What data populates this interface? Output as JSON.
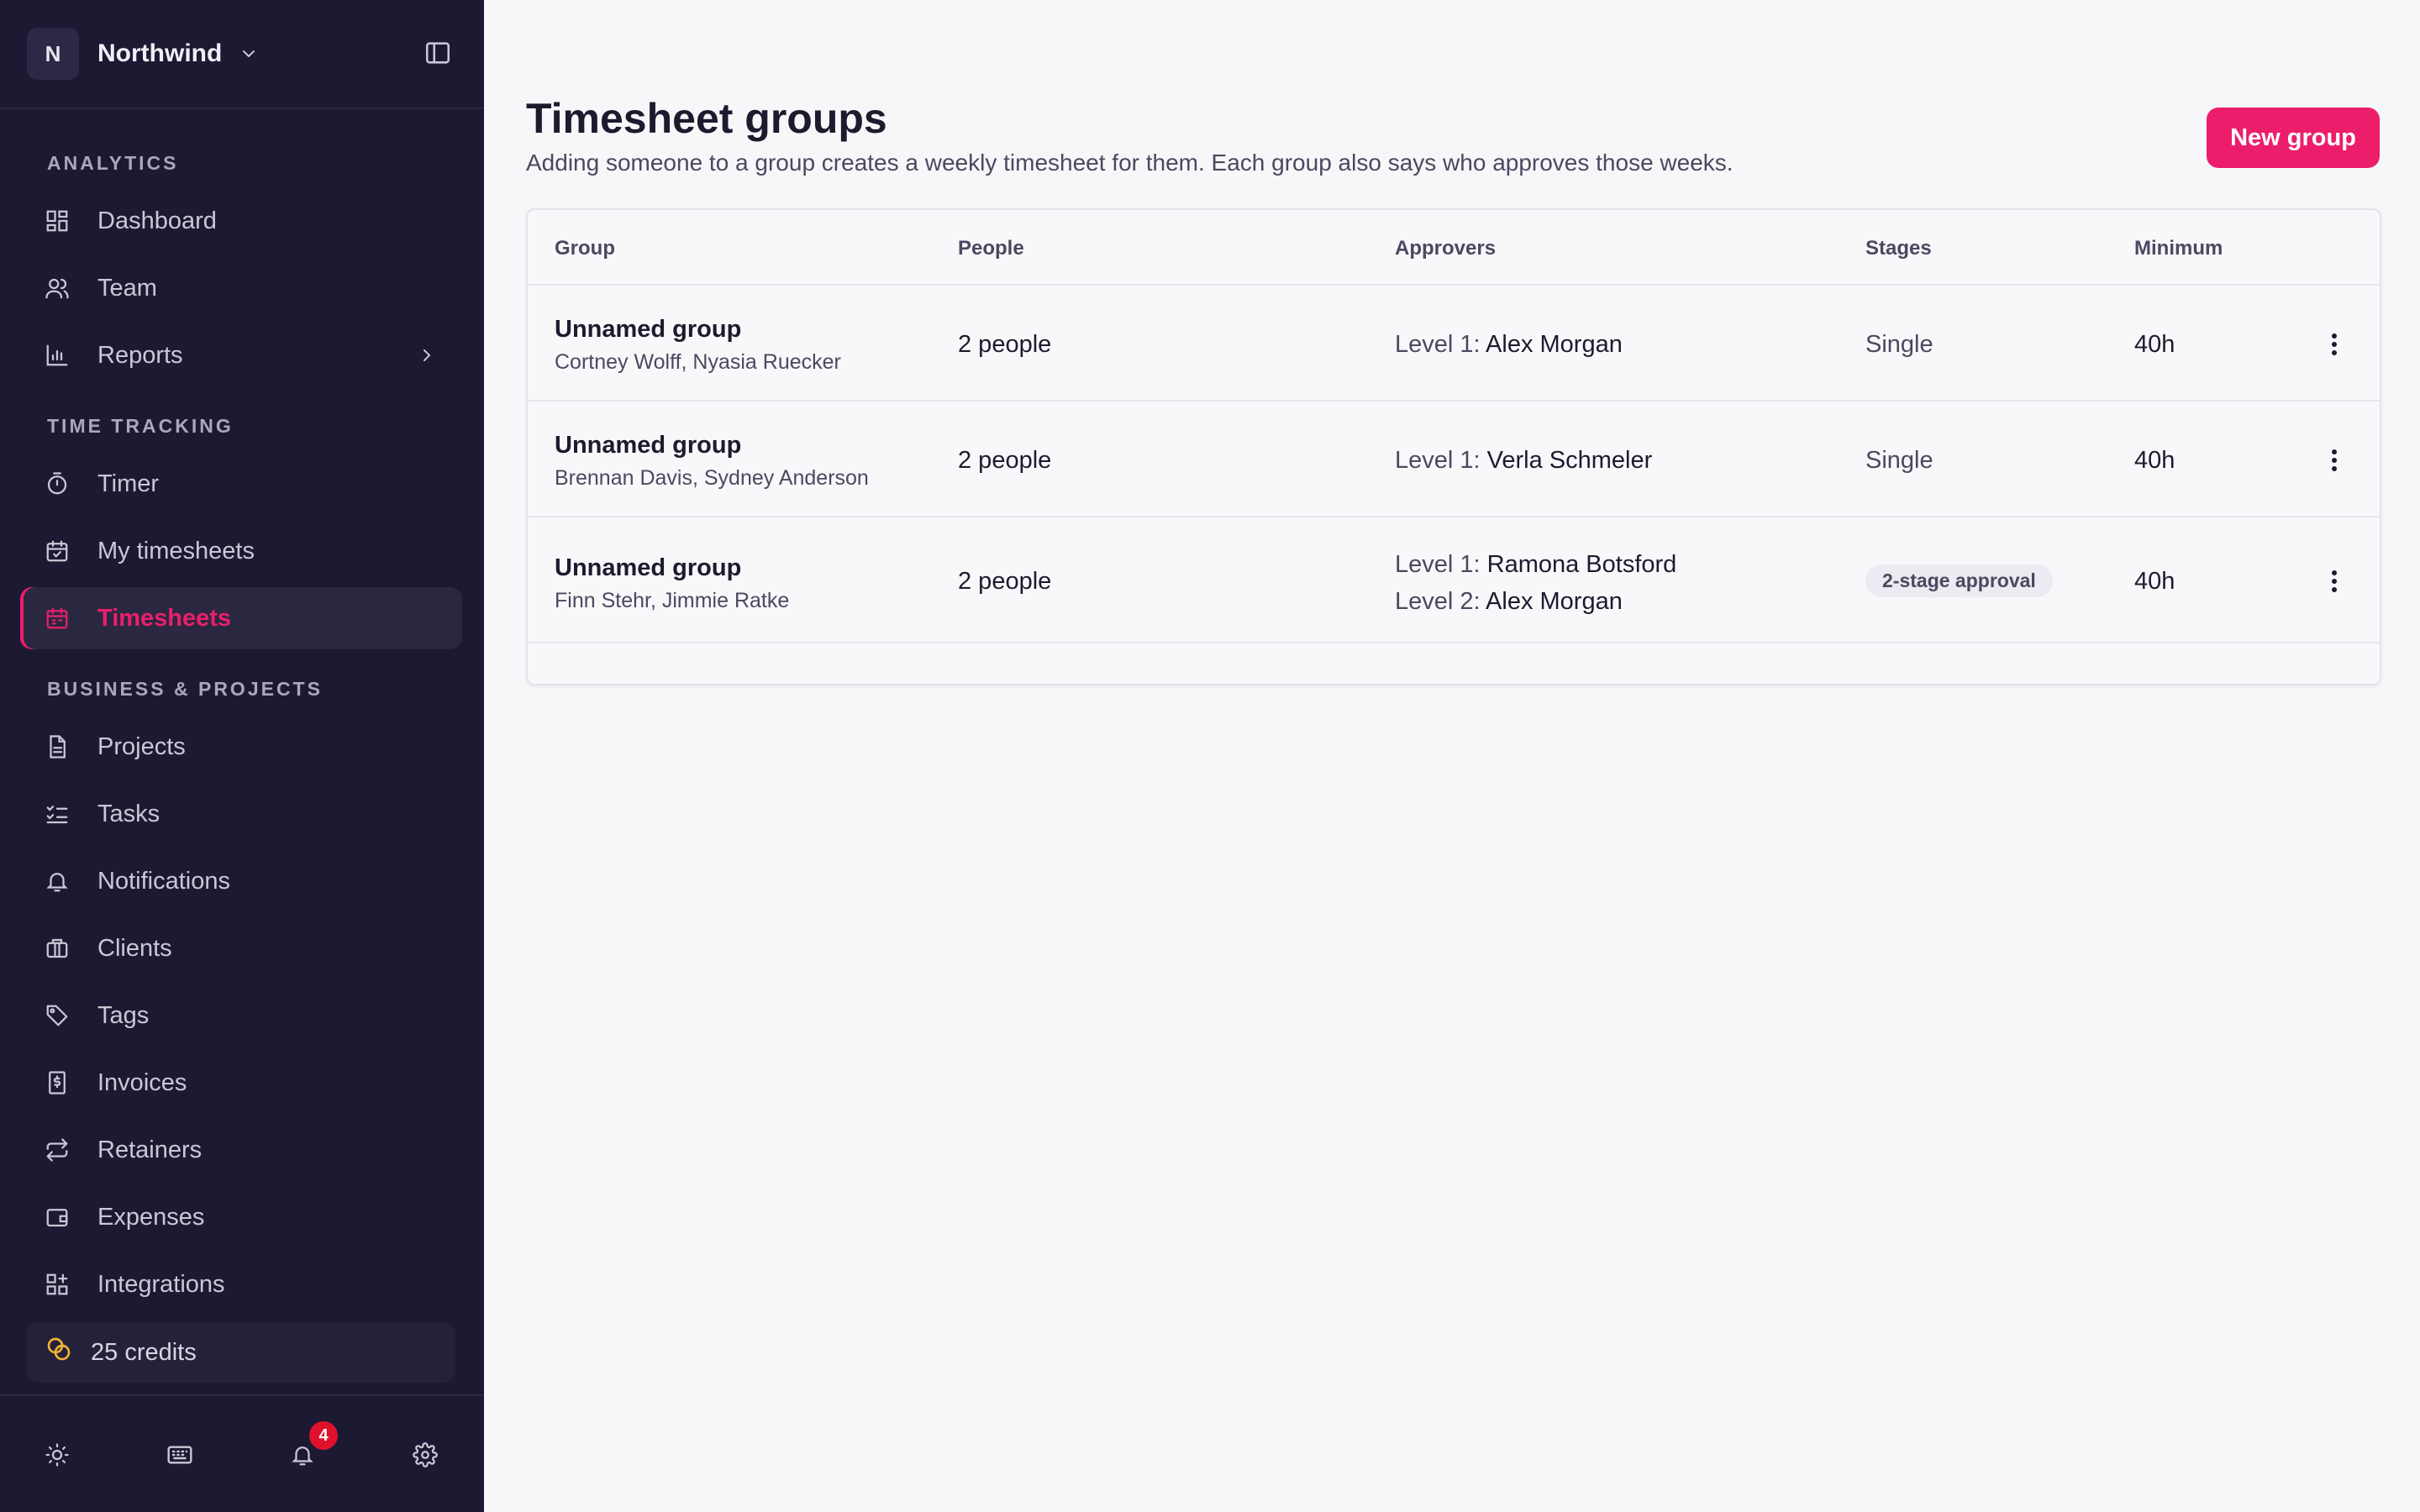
{
  "workspace": {
    "initial": "N",
    "name": "Northwind"
  },
  "sidebar": {
    "sections": [
      {
        "title": "ANALYTICS",
        "items": [
          {
            "label": "Dashboard",
            "icon": "dashboard-icon"
          },
          {
            "label": "Team",
            "icon": "users-icon"
          },
          {
            "label": "Reports",
            "icon": "bar-chart-icon"
          }
        ]
      },
      {
        "title": "TIME TRACKING",
        "items": [
          {
            "label": "Timer",
            "icon": "stopwatch-icon"
          },
          {
            "label": "My timesheets",
            "icon": "calendar-check-icon"
          },
          {
            "label": "Timesheets",
            "icon": "calendar-icon"
          }
        ]
      },
      {
        "title": "BUSINESS & PROJECTS",
        "items": [
          {
            "label": "Projects",
            "icon": "document-icon"
          },
          {
            "label": "Tasks",
            "icon": "checklist-icon"
          },
          {
            "label": "Notifications",
            "icon": "bell-icon"
          },
          {
            "label": "Clients",
            "icon": "briefcase-icon"
          },
          {
            "label": "Tags",
            "icon": "tag-icon"
          },
          {
            "label": "Invoices",
            "icon": "invoice-icon"
          },
          {
            "label": "Retainers",
            "icon": "repeat-icon"
          },
          {
            "label": "Expenses",
            "icon": "wallet-icon"
          },
          {
            "label": "Integrations",
            "icon": "grid-plus-icon"
          }
        ]
      }
    ],
    "active_item": "Timesheets",
    "credits": "25 credits",
    "notification_count": "4"
  },
  "page": {
    "title": "Timesheet groups",
    "subtitle": "Adding someone to a group creates a weekly timesheet for them. Each group also says who approves those weeks.",
    "new_button": "New group"
  },
  "table": {
    "headers": {
      "group": "Group",
      "people": "People",
      "approvers": "Approvers",
      "stages": "Stages",
      "minimum": "Minimum"
    },
    "rows": [
      {
        "name": "Unnamed group",
        "members": "Cortney Wolff, Nyasia Ruecker",
        "people": "2 people",
        "approvers": [
          {
            "level": "Level 1:",
            "name": "Alex Morgan"
          }
        ],
        "stages": "Single",
        "minimum": "40h"
      },
      {
        "name": "Unnamed group",
        "members": "Brennan Davis, Sydney Anderson",
        "people": "2 people",
        "approvers": [
          {
            "level": "Level 1:",
            "name": "Verla Schmeler"
          }
        ],
        "stages": "Single",
        "minimum": "40h"
      },
      {
        "name": "Unnamed group",
        "members": "Finn Stehr, Jimmie Ratke",
        "people": "2 people",
        "approvers": [
          {
            "level": "Level 1:",
            "name": "Ramona Botsford"
          },
          {
            "level": "Level 2:",
            "name": "Alex Morgan"
          }
        ],
        "stages": "2-stage approval",
        "minimum": "40h"
      }
    ]
  },
  "colors": {
    "accent": "#ec1e6b",
    "sidebar_bg": "#1c1a33",
    "credits_icon": "#f2b233",
    "badge": "#e0122b"
  }
}
